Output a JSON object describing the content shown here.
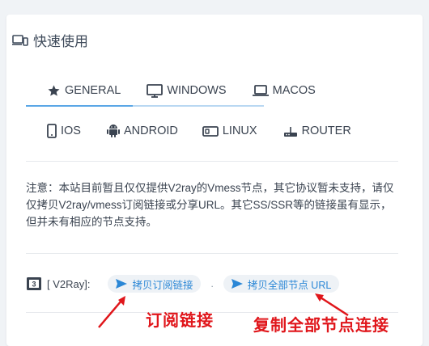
{
  "card": {
    "title": "快速使用",
    "title_icon": "devices-icon"
  },
  "tabs_row1": [
    {
      "label": "GENERAL",
      "icon": "star-icon",
      "active": true
    },
    {
      "label": "WINDOWS",
      "icon": "monitor-icon",
      "active": false
    },
    {
      "label": "MACOS",
      "icon": "laptop-icon",
      "active": false
    }
  ],
  "tabs_row2": [
    {
      "label": "IOS",
      "icon": "phone-icon"
    },
    {
      "label": "ANDROID",
      "icon": "android-icon"
    },
    {
      "label": "LINUX",
      "icon": "linux-box-icon"
    },
    {
      "label": "ROUTER",
      "icon": "router-icon"
    }
  ],
  "notice": {
    "text": "注意：本站目前暂且仅仅提供V2ray的Vmess节点，其它协议暂未支持，请仅仅拷贝V2ray/vmess订阅链接或分享URL。其它SS/SSR等的链接虽有显示，但并未有相应的节点支持。"
  },
  "subscription": {
    "label": "[ V2Ray]:",
    "copy_sub_label": "拷贝订阅链接",
    "separator": ".",
    "copy_all_label": "拷贝全部节点 URL"
  },
  "annotations": {
    "left": "订阅链接",
    "right": "复制全部节点连接"
  },
  "colors": {
    "accent": "#2b87d6",
    "annotation": "#e0161b",
    "text": "#3a4350"
  }
}
